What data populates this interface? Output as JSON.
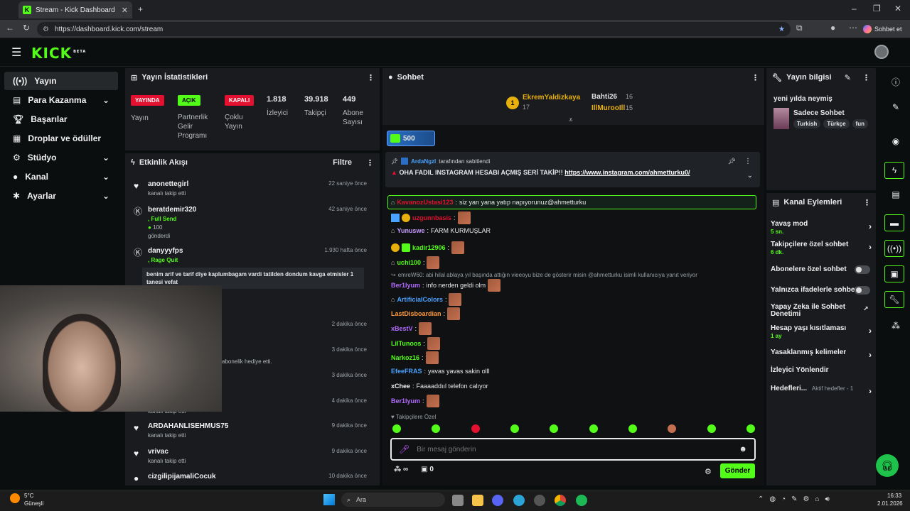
{
  "browser": {
    "tab_title": "Stream - Kick Dashboard",
    "url": "https://dashboard.kick.com/stream",
    "chat_button": "Sohbet et"
  },
  "app": {
    "logo": "KICK",
    "logo_badge": "BETA"
  },
  "nav": [
    {
      "label": "Yayın",
      "icon": "broadcast-icon"
    },
    {
      "label": "Para Kazanma",
      "icon": "money-icon"
    },
    {
      "label": "Başarılar",
      "icon": "trophy-icon"
    },
    {
      "label": "Droplar ve ödüller",
      "icon": "gift-icon"
    },
    {
      "label": "Stüdyo",
      "icon": "gear-icon"
    },
    {
      "label": "Kanal",
      "icon": "user-icon"
    },
    {
      "label": "Ayarlar",
      "icon": "settings-icon"
    }
  ],
  "stats": {
    "title": "Yayın İstatistikleri",
    "items": [
      {
        "badge": "YAYINDA",
        "label": "Yayın",
        "color": "#e3102f"
      },
      {
        "badge": "AÇIK",
        "label": "Partnerlik Gelir Programı",
        "color": "#53fc18"
      },
      {
        "badge": "KAPALI",
        "label": "Çoklu Yayın",
        "color": "#e3102f"
      },
      {
        "value": "1.818",
        "label": "İzleyici"
      },
      {
        "value": "39.918",
        "label": "Takipçi"
      },
      {
        "value": "449",
        "label": "Abone Sayısı"
      }
    ]
  },
  "activity": {
    "title": "Etkinlik Akışı",
    "filter": "Filtre",
    "events": [
      {
        "name": "anonettegirl",
        "sub": "kanalı takip etti",
        "time": "22 saniye önce"
      },
      {
        "name": "beratdemir320",
        "sub": ", Full Send",
        "extra": "100",
        "sub2": "gönderdi",
        "time": "42 saniye önce"
      },
      {
        "name": "danyyyfps",
        "sub": ", Rage Quit",
        "quote": "benim arif ve tarif diye kaplumbagam vardi tatilden dondum kavga etmisler 1 tanesi vefat",
        "time": "1.930 hafta önce"
      },
      {
        "time": "2 dakika önce"
      },
      {
        "sub": "abonelik hediye etti.",
        "time": "3 dakika önce"
      },
      {
        "time": "3 dakika önce"
      },
      {
        "sub": "kanalı takip etti",
        "time": "4 dakika önce"
      },
      {
        "name": "ARDAHANLISEHMUS75",
        "sub": "kanalı takip etti",
        "time": "9 dakika önce"
      },
      {
        "name": "vrivac",
        "sub": "kanalı takip etti",
        "time": "9 dakika önce"
      },
      {
        "name": "cizgilipijamaliCocuk",
        "time": "10 dakika önce"
      }
    ]
  },
  "chat": {
    "title": "Sohbet",
    "leaders": [
      {
        "name": "EkremYaldizkaya",
        "count": "17",
        "rank": "1"
      },
      {
        "name": "Bahti26",
        "count": "16"
      },
      {
        "name": "IllMurooIll",
        "count": "15"
      }
    ],
    "goal": "500",
    "pinned_by": "ArdaNgzl",
    "pinned_suffix": "tarafından sabitlendi",
    "pinned_text": "OHA FADIL INSTAGRAM HESABI AÇMIŞ SERİ TAKİP!!",
    "pinned_link": "https://www.instagram.com/ahmetturku0/",
    "messages": [
      {
        "user": "KavanozUstasi123",
        "text": "siz yan yana yatıp napıyorunuz@ahmetturku",
        "color": "#e3102f",
        "highlight": true
      },
      {
        "user": "uzgunnbasis",
        "text": "",
        "color": "#e3102f"
      },
      {
        "user": "Yunuswe",
        "text": "FARM KURMUŞLAR",
        "color": "#c89bff"
      },
      {
        "user": "kadir12906",
        "text": "",
        "color": "#53fc18"
      },
      {
        "user": "uchi100",
        "text": "",
        "color": "#53fc18"
      },
      {
        "reply": "emreW60: abi hilal ablaya yıl başında attığın vieeoyu bize de gösterir misin @ahmetturku isimli kullanıcıya yanıt veriyor"
      },
      {
        "user": "Ber1lyum",
        "text": "info nerden geldi olm",
        "color": "#b46bff"
      },
      {
        "user": "ArtificialColors",
        "text": "",
        "color": "#4aa3ff"
      },
      {
        "user": "LastDisboardian",
        "text": "",
        "color": "#ff9a3c"
      },
      {
        "user": "xBestV",
        "text": "",
        "color": "#b46bff"
      },
      {
        "user": "LilTunoos",
        "text": "",
        "color": "#53fc18"
      },
      {
        "user": "Narkoz16",
        "text": "",
        "color": "#53fc18"
      },
      {
        "user": "EfeeFRAS",
        "text": "yavas yavas sakin olll",
        "color": "#4aa3ff"
      },
      {
        "user": "xChee",
        "text": "Faaaaddııl telefon calıyor",
        "color": "#f0f0f0"
      },
      {
        "user": "Ber1lyum",
        "text": "",
        "color": "#b46bff"
      }
    ],
    "emote_section": "Takipçilere Özel",
    "input_placeholder": "Bir mesaj gönderin",
    "points": "∞",
    "gift_count": "0",
    "send": "Gönder"
  },
  "stream_info": {
    "title": "Yayın bilgisi",
    "stream_title": "yeni yılda neymiş",
    "category": "Sadece Sohbet",
    "tags": [
      "Turkish",
      "Türkçe",
      "fun"
    ]
  },
  "channel_actions": {
    "title": "Kanal Eylemleri",
    "items": [
      {
        "label": "Yavaş mod",
        "sub": "5 sn.",
        "kind": "arrow"
      },
      {
        "label": "Takipçilere özel sohbet",
        "sub": "6 dk.",
        "kind": "arrow"
      },
      {
        "label": "Abonelere özel sohbet",
        "kind": "toggle"
      },
      {
        "label": "Yalnızca ifadelerle sohbet",
        "kind": "toggle"
      },
      {
        "label": "Yapay Zeka ile Sohbet Denetimi",
        "kind": "external"
      },
      {
        "label": "Hesap yaşı kısıtlaması",
        "sub": "1 ay",
        "kind": "arrow"
      },
      {
        "label": "Yasaklanmış kelimeler",
        "kind": "arrow"
      },
      {
        "label": "İzleyici Yönlendir",
        "kind": "none"
      },
      {
        "label": "Hedefleri...",
        "sub": "Aktif hedefler - 1",
        "kind": "arrow"
      }
    ]
  },
  "taskbar": {
    "weather_temp": "5°C",
    "weather_desc": "Güneşli",
    "search": "Ara",
    "time": "16:33",
    "date": "2.01.2026"
  }
}
